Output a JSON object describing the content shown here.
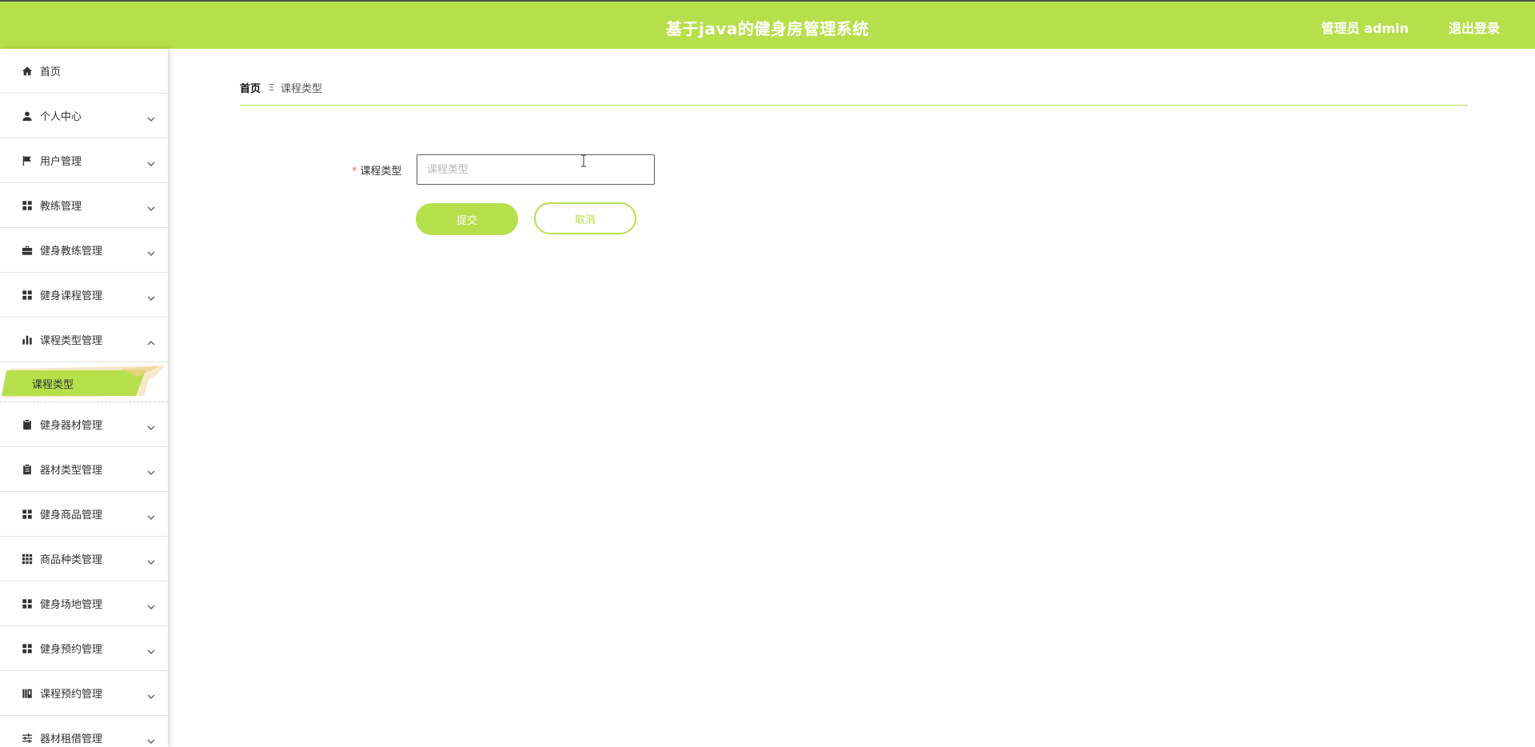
{
  "header": {
    "title": "基于java的健身房管理系统",
    "user_label": "管理员 admin",
    "logout_label": "退出登录",
    "bg_color": "#b6e04b"
  },
  "sidebar": {
    "items": [
      {
        "label": "首页",
        "icon": "home-icon",
        "expandable": false
      },
      {
        "label": "个人中心",
        "icon": "user-icon",
        "expandable": true
      },
      {
        "label": "用户管理",
        "icon": "flag-icon",
        "expandable": true
      },
      {
        "label": "教练管理",
        "icon": "grid-icon",
        "expandable": true
      },
      {
        "label": "健身教练管理",
        "icon": "briefcase-icon",
        "expandable": true
      },
      {
        "label": "健身课程管理",
        "icon": "grid-icon",
        "expandable": true
      },
      {
        "label": "课程类型管理",
        "icon": "bar-chart-icon",
        "expandable": true,
        "expanded": true
      },
      {
        "label": "健身器材管理",
        "icon": "clipboard-check-icon",
        "expandable": true
      },
      {
        "label": "器材类型管理",
        "icon": "clipboard-icon",
        "expandable": true
      },
      {
        "label": "健身商品管理",
        "icon": "grid-icon",
        "expandable": true
      },
      {
        "label": "商品种类管理",
        "icon": "grid-3x3-icon",
        "expandable": true
      },
      {
        "label": "健身场地管理",
        "icon": "grid-icon",
        "expandable": true
      },
      {
        "label": "健身预约管理",
        "icon": "grid-icon",
        "expandable": true
      },
      {
        "label": "课程预约管理",
        "icon": "book-icon",
        "expandable": true
      },
      {
        "label": "器材租借管理",
        "icon": "sliders-icon",
        "expandable": true
      }
    ],
    "active_sub": "课程类型"
  },
  "breadcrumb": {
    "home": "首页",
    "separator": "Ξ",
    "current": "课程类型"
  },
  "form": {
    "field_label": "课程类型",
    "required_mark": "*",
    "field_value": "",
    "field_placeholder": "课程类型",
    "submit_label": "提交",
    "cancel_label": "取消"
  }
}
